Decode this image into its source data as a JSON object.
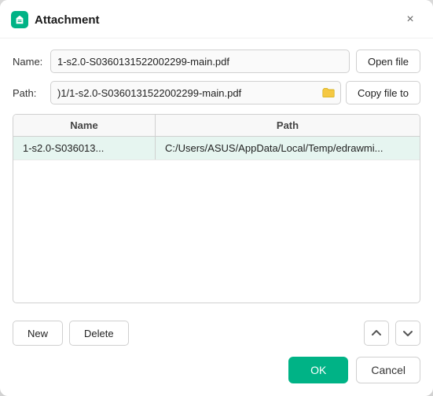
{
  "dialog": {
    "title": "Attachment",
    "close_label": "×"
  },
  "name_field": {
    "label": "Name:",
    "value": "1-s2.0-S0360131522002299-main.pdf",
    "open_file_label": "Open file"
  },
  "path_field": {
    "label": "Path:",
    "value": ")1/1-s2.0-S0360131522002299-main.pdf",
    "copy_file_label": "Copy file to"
  },
  "table": {
    "col_name": "Name",
    "col_path": "Path",
    "rows": [
      {
        "name": "1-s2.0-S036013...",
        "path": "C:/Users/ASUS/AppData/Local/Temp/edrawmi..."
      }
    ]
  },
  "footer": {
    "new_label": "New",
    "delete_label": "Delete",
    "up_arrow": "↑",
    "down_arrow": "↓"
  },
  "actions": {
    "ok_label": "OK",
    "cancel_label": "Cancel"
  }
}
